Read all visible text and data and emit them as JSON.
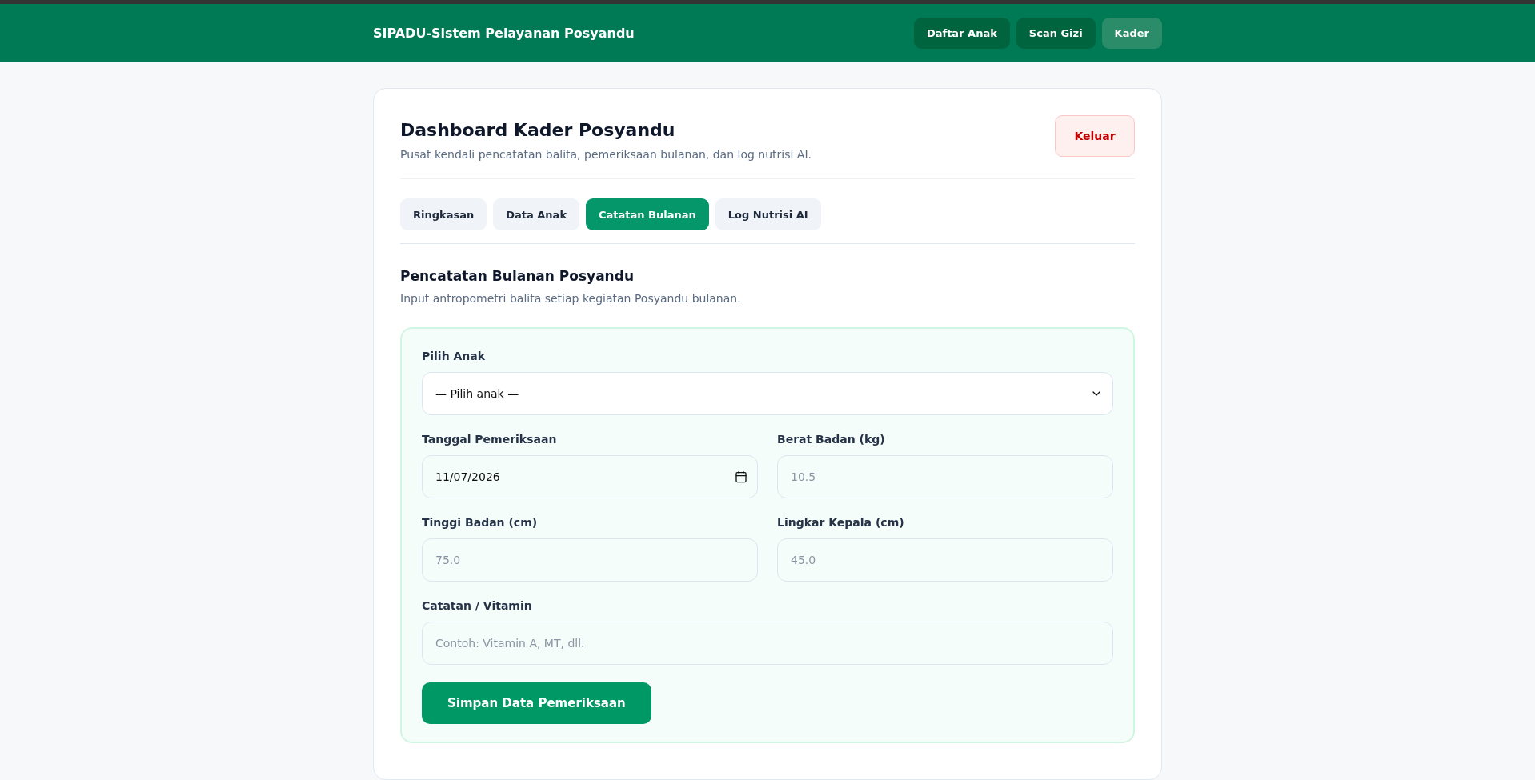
{
  "header": {
    "title": "SIPADU-Sistem Pelayanan Posyandu",
    "nav": [
      {
        "label": "Daftar Anak",
        "selected": false
      },
      {
        "label": "Scan Gizi",
        "selected": false
      },
      {
        "label": "Kader",
        "selected": true
      }
    ]
  },
  "dashboard": {
    "title": "Dashboard Kader Posyandu",
    "subtitle": "Pusat kendali pencatatan balita, pemeriksaan bulanan, dan log nutrisi AI.",
    "logout": "Keluar"
  },
  "tabs": [
    {
      "label": "Ringkasan",
      "selected": false
    },
    {
      "label": "Data Anak",
      "selected": false
    },
    {
      "label": "Catatan Bulanan",
      "selected": true
    },
    {
      "label": "Log Nutrisi AI",
      "selected": false
    }
  ],
  "section": {
    "title": "Pencatatan Bulanan Posyandu",
    "subtitle": "Input antropometri balita setiap kegiatan Posyandu bulanan."
  },
  "form": {
    "rows": [
      [
        {
          "kind": "select",
          "label": "Pilih Anak",
          "value": "— Pilih anak —"
        }
      ],
      [
        {
          "kind": "date",
          "label": "Tanggal Pemeriksaan",
          "value": "11/07/2026"
        },
        {
          "kind": "text",
          "label": "Berat Badan (kg)",
          "placeholder": "10.5"
        }
      ],
      [
        {
          "kind": "text",
          "label": "Tinggi Badan (cm)",
          "placeholder": "75.0"
        },
        {
          "kind": "text",
          "label": "Lingkar Kepala (cm)",
          "placeholder": "45.0"
        }
      ],
      [
        {
          "kind": "text",
          "label": "Catatan / Vitamin",
          "placeholder": "Contoh: Vitamin A, MT, dll."
        }
      ]
    ],
    "submit": "Simpan Data Pemeriksaan"
  }
}
